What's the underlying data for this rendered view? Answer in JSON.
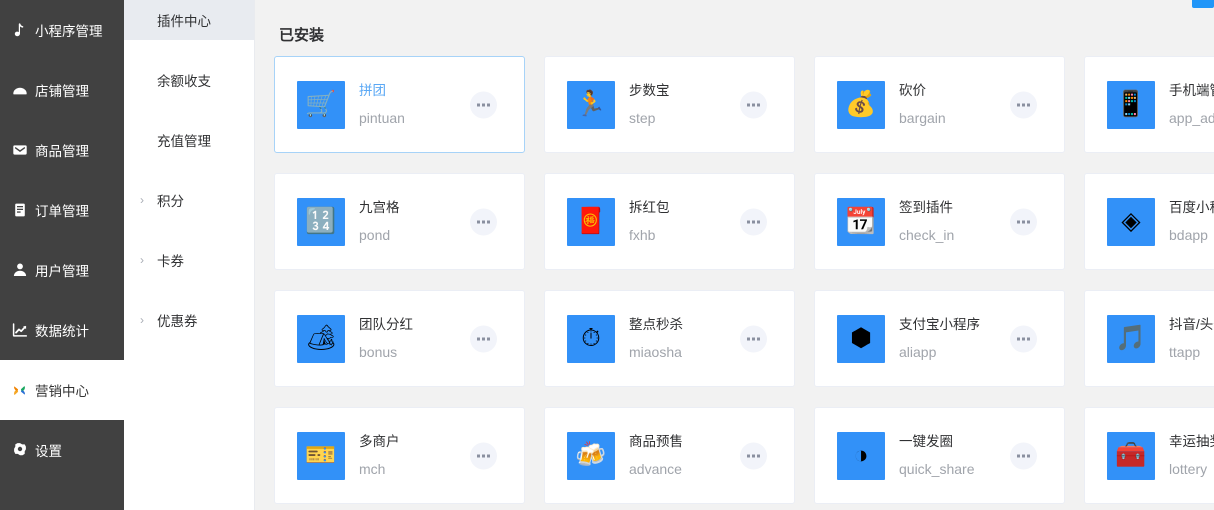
{
  "sidebar_primary": {
    "items": [
      {
        "label": "小程序管理",
        "icon": "mini-program-icon",
        "active": false
      },
      {
        "label": "店铺管理",
        "icon": "shop-icon",
        "active": false
      },
      {
        "label": "商品管理",
        "icon": "goods-icon",
        "active": false
      },
      {
        "label": "订单管理",
        "icon": "order-icon",
        "active": false
      },
      {
        "label": "用户管理",
        "icon": "user-icon",
        "active": false
      },
      {
        "label": "数据统计",
        "icon": "chart-icon",
        "active": false
      },
      {
        "label": "营销中心",
        "icon": "marketing-flower-icon",
        "active": true
      },
      {
        "label": "设置",
        "icon": "gear-icon",
        "active": false
      }
    ]
  },
  "sidebar_secondary": {
    "items": [
      {
        "label": "插件中心",
        "active": true,
        "expandable": false
      },
      {
        "label": "余额收支",
        "active": false,
        "expandable": false
      },
      {
        "label": "充值管理",
        "active": false,
        "expandable": false
      },
      {
        "label": "积分",
        "active": false,
        "expandable": true
      },
      {
        "label": "卡券",
        "active": false,
        "expandable": true
      },
      {
        "label": "优惠券",
        "active": false,
        "expandable": true
      }
    ],
    "chevron": "›"
  },
  "main": {
    "section_title": "已安装",
    "more_button_label": "…",
    "plugins": [
      {
        "title": "拼团",
        "slug": "pintuan",
        "emoji": "🛒",
        "selected": true
      },
      {
        "title": "步数宝",
        "slug": "step",
        "emoji": "🏃",
        "selected": false
      },
      {
        "title": "砍价",
        "slug": "bargain",
        "emoji": "💰",
        "selected": false
      },
      {
        "title": "手机端管理",
        "slug": "app_admin",
        "emoji": "📱",
        "selected": false
      },
      {
        "title": "九宫格",
        "slug": "pond",
        "emoji": "🔢",
        "selected": false
      },
      {
        "title": "拆红包",
        "slug": "fxhb",
        "emoji": "🧧",
        "selected": false
      },
      {
        "title": "签到插件",
        "slug": "check_in",
        "emoji": "📆",
        "selected": false
      },
      {
        "title": "百度小程序",
        "slug": "bdapp",
        "emoji": "◈",
        "selected": false
      },
      {
        "title": "团队分红",
        "slug": "bonus",
        "emoji": "🏕",
        "selected": false
      },
      {
        "title": "整点秒杀",
        "slug": "miaosha",
        "emoji": "⏱",
        "selected": false
      },
      {
        "title": "支付宝小程序",
        "slug": "aliapp",
        "emoji": "⬢",
        "selected": false
      },
      {
        "title": "抖音/头条",
        "slug": "ttapp",
        "emoji": "🎵",
        "selected": false
      },
      {
        "title": "多商户",
        "slug": "mch",
        "emoji": "🎫",
        "selected": false
      },
      {
        "title": "商品预售",
        "slug": "advance",
        "emoji": "🍻",
        "selected": false
      },
      {
        "title": "一键发圈",
        "slug": "quick_share",
        "emoji": "◑",
        "selected": false
      },
      {
        "title": "幸运抽奖",
        "slug": "lottery",
        "emoji": "🧰",
        "selected": false
      }
    ]
  },
  "colors": {
    "sidebar_bg": "#414141",
    "accent_blue": "#3291f8",
    "card_border": "#ebeef5",
    "selected_border": "#a7d3f8",
    "selected_title": "#5aa8f5",
    "page_bg": "#f2f2f2",
    "submenu_active_bg": "#e8ebf0"
  }
}
